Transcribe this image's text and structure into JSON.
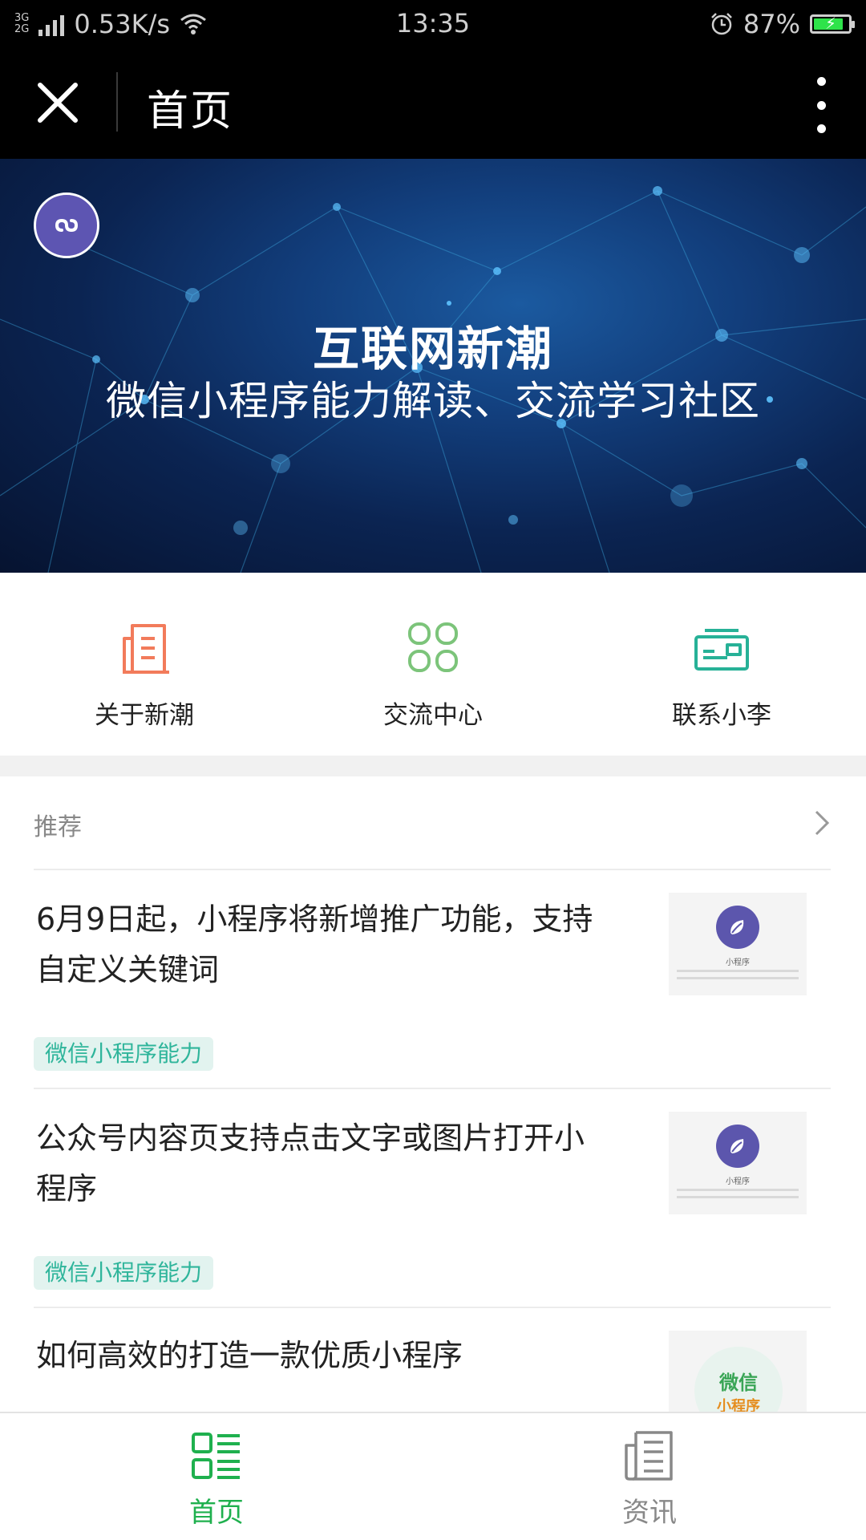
{
  "status_bar": {
    "network_type_top": "3G",
    "network_type_bottom": "2G",
    "speed": "0.53K/s",
    "time": "13:35",
    "battery": "87%",
    "battery_level": 0.87,
    "icons": [
      "signal-icon",
      "wifi-icon",
      "alarm-icon",
      "battery-icon"
    ]
  },
  "nav": {
    "title": "首页",
    "close_icon": "close-icon",
    "more_icon": "more-vertical-icon"
  },
  "banner": {
    "title": "互联网新潮",
    "subtitle": "微信小程序能力解读、交流学习社区",
    "badge_icon": "mini-program-icon"
  },
  "quick_nav": [
    {
      "label": "关于新潮",
      "icon": "building-icon",
      "color": "#f27b5b"
    },
    {
      "label": "交流中心",
      "icon": "grid-icon",
      "color": "#7cc47a"
    },
    {
      "label": "联系小李",
      "icon": "card-icon",
      "color": "#27b197"
    }
  ],
  "recommend": {
    "label": "推荐",
    "arrow_icon": "chevron-right-icon",
    "articles": [
      {
        "title": "6月9日起，小程序将新增推广功能，支持自定义关键词",
        "tag": "微信小程序能力",
        "thumb_caption": "小程序"
      },
      {
        "title": "公众号内容页支持点击文字或图片打开小程序",
        "tag": "微信小程序能力",
        "thumb_caption": "小程序"
      },
      {
        "title": "如何高效的打造一款优质小程序",
        "thumb_line1": "微信",
        "thumb_line2": "小程序"
      }
    ]
  },
  "tab_bar": [
    {
      "label": "首页",
      "icon": "list-icon",
      "active": true,
      "color": "#1fb04e"
    },
    {
      "label": "资讯",
      "icon": "newspaper-icon",
      "active": false,
      "color": "#888888"
    }
  ]
}
